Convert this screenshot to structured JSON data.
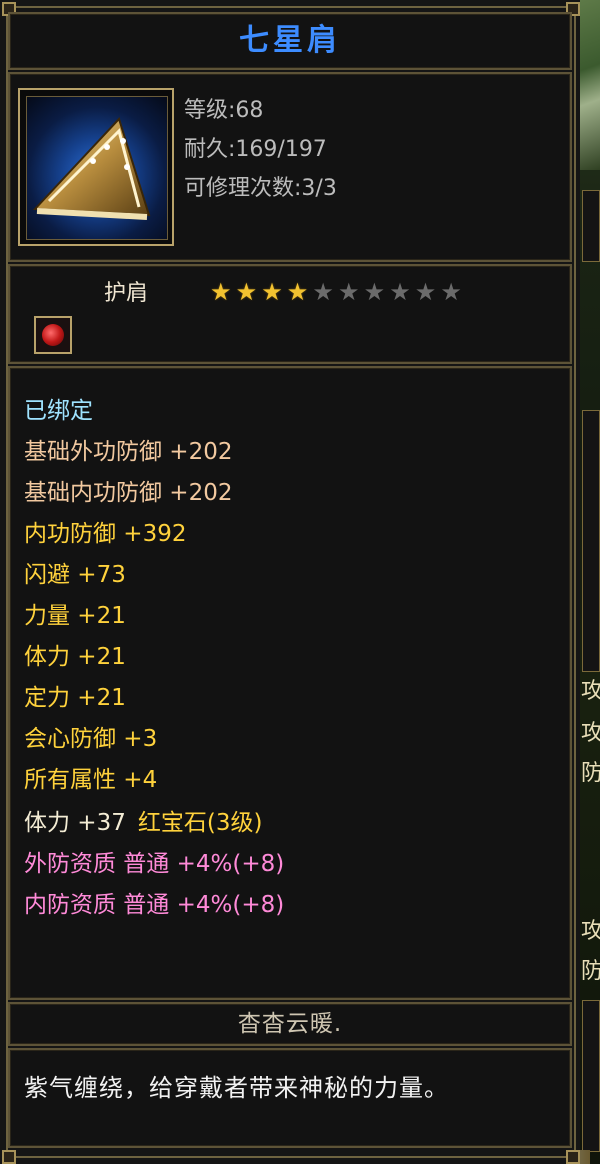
{
  "item": {
    "name": "七星肩",
    "level": "等级:68",
    "durability": "耐久:169/197",
    "repairs": "可修理次数:3/3",
    "type": "护肩",
    "stars": {
      "filled": 4,
      "total": 10
    },
    "bound": "已绑定",
    "stats": [
      {
        "text": "基础外功防御  +202",
        "color": "peach"
      },
      {
        "text": "基础内功防御  +202",
        "color": "peach"
      },
      {
        "text": "内功防御  +392",
        "color": "yellow"
      },
      {
        "text": "闪避  +73",
        "color": "yellow"
      },
      {
        "text": "力量  +21",
        "color": "yellow"
      },
      {
        "text": "体力  +21",
        "color": "yellow"
      },
      {
        "text": "定力  +21",
        "color": "yellow"
      },
      {
        "text": "会心防御  +3",
        "color": "yellow"
      },
      {
        "text": "所有属性  +4",
        "color": "yellow"
      }
    ],
    "gem_line": {
      "stat": "体力  +37",
      "gem": "红宝石(3级)"
    },
    "qualities": [
      {
        "text": "外防资质  普通 +4%(+8)"
      },
      {
        "text": "内防资质  普通 +4%(+8)"
      }
    ],
    "crafter": "杳杳云暖.",
    "description": "紫气缠绕，给穿戴者带来神秘的力量。"
  },
  "background_glyphs": [
    "攻",
    "攻",
    "防",
    "攻",
    "防"
  ],
  "colors": {
    "title": "#3d8cff",
    "bound": "#9fe3ff",
    "base_stat": "#f2c9a0",
    "bonus_stat": "#ffd23c",
    "gem": "#ffd23c",
    "quality": "#ff8ad8",
    "star_on": "#f2c230",
    "star_off": "#6b6b6b"
  }
}
